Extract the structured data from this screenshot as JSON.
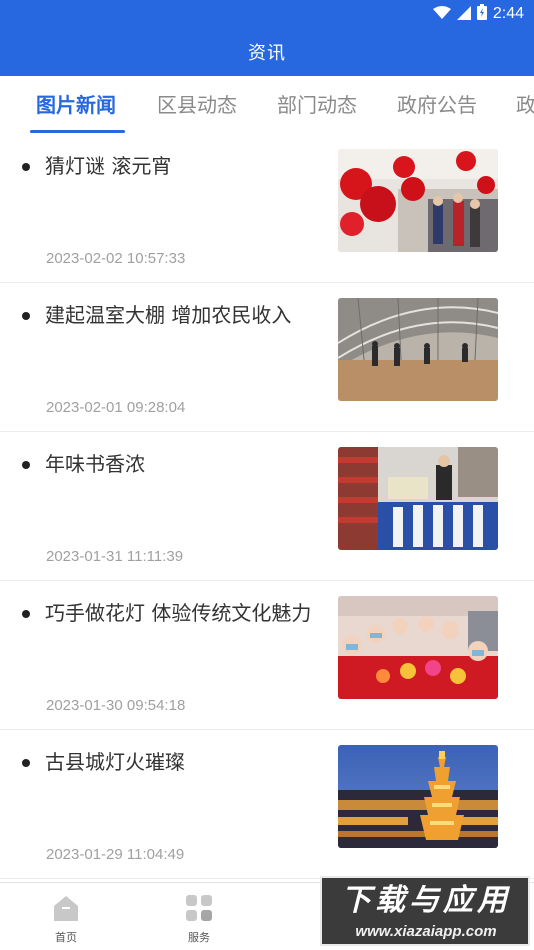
{
  "status_bar": {
    "time": "2:44",
    "icons": [
      "wifi-icon",
      "signal-icon",
      "battery-icon"
    ]
  },
  "header": {
    "title": "资讯"
  },
  "tabs": [
    {
      "label": "图片新闻",
      "active": true
    },
    {
      "label": "区县动态",
      "active": false
    },
    {
      "label": "部门动态",
      "active": false
    },
    {
      "label": "政府公告",
      "active": false
    },
    {
      "label": "政",
      "active": false
    }
  ],
  "news": [
    {
      "title": "猜灯谜 滚元宵",
      "time": "2023-02-02 10:57:33",
      "image": "lanterns-photo"
    },
    {
      "title": "建起温室大棚 增加农民收入",
      "time": "2023-02-01 09:28:04",
      "image": "greenhouse-photo"
    },
    {
      "title": "年味书香浓",
      "time": "2023-01-31 11:11:39",
      "image": "bookstore-photo"
    },
    {
      "title": "巧手做花灯 体验传统文化魅力",
      "time": "2023-01-30 09:54:18",
      "image": "children-lanterns-photo"
    },
    {
      "title": "古县城灯火璀璨",
      "time": "2023-01-29 11:04:49",
      "image": "night-city-photo"
    }
  ],
  "bottom_nav": [
    {
      "label": "首页",
      "icon": "home-icon"
    },
    {
      "label": "服务",
      "icon": "grid-icon"
    }
  ],
  "watermark": {
    "main": "下载与应用",
    "url": "www.xiazaiapp.com"
  },
  "colors": {
    "primary": "#2768e0",
    "text": "#333333",
    "muted": "#a0a0a0"
  }
}
